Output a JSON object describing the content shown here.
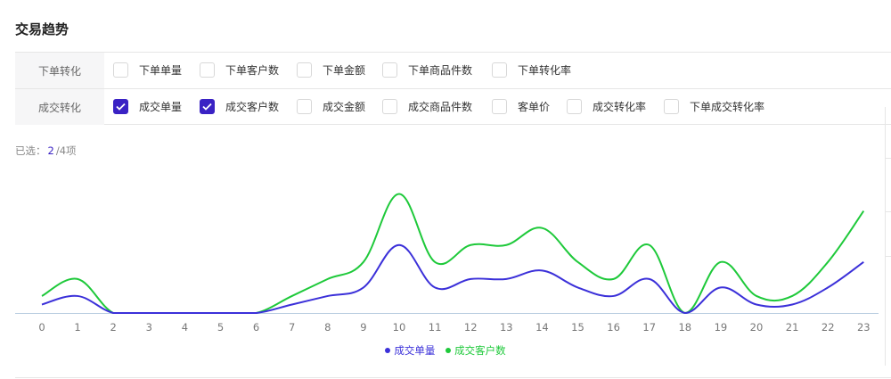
{
  "title": "交易趋势",
  "filters": {
    "row1": {
      "label": "下单转化",
      "options": [
        {
          "label": "下单单量",
          "checked": false
        },
        {
          "label": "下单客户数",
          "checked": false
        },
        {
          "label": "下单金额",
          "checked": false
        },
        {
          "label": "下单商品件数",
          "checked": false
        },
        {
          "label": "下单转化率",
          "checked": false
        }
      ]
    },
    "row2": {
      "label": "成交转化",
      "options": [
        {
          "label": "成交单量",
          "checked": true
        },
        {
          "label": "成交客户数",
          "checked": true
        },
        {
          "label": "成交金额",
          "checked": false
        },
        {
          "label": "成交商品件数",
          "checked": false
        },
        {
          "label": "客单价",
          "checked": false
        },
        {
          "label": "成交转化率",
          "checked": false
        },
        {
          "label": "下单成交转化率",
          "checked": false
        }
      ]
    }
  },
  "selected": {
    "prefix": "已选：",
    "count": "2",
    "suffix": "/4项"
  },
  "colors": {
    "accent": "#3a22c4",
    "series1": "#3b30d9",
    "series2": "#1ec93a",
    "axis": "#b9cde0"
  },
  "chart_data": {
    "type": "line",
    "x": [
      "0",
      "1",
      "2",
      "3",
      "4",
      "5",
      "6",
      "7",
      "8",
      "9",
      "10",
      "11",
      "12",
      "13",
      "14",
      "15",
      "16",
      "17",
      "18",
      "19",
      "20",
      "21",
      "22",
      "23"
    ],
    "ylim": [
      0,
      7.5
    ],
    "grid": false,
    "legend": "bottom",
    "series": [
      {
        "name": "成交单量",
        "color": "#3b30d9",
        "values": [
          0.5,
          1,
          0,
          0,
          0,
          0,
          0,
          0.5,
          1,
          1.5,
          4,
          1.5,
          2,
          2,
          2.5,
          1.5,
          1,
          2,
          0,
          1.5,
          0.5,
          0.5,
          1.5,
          3
        ]
      },
      {
        "name": "成交客户数",
        "color": "#1ec93a",
        "values": [
          1,
          2,
          0,
          0,
          0,
          0,
          0,
          1,
          2,
          3,
          7,
          3,
          4,
          4,
          5,
          3,
          2,
          4,
          0,
          3,
          1,
          1,
          3,
          6
        ]
      }
    ]
  }
}
